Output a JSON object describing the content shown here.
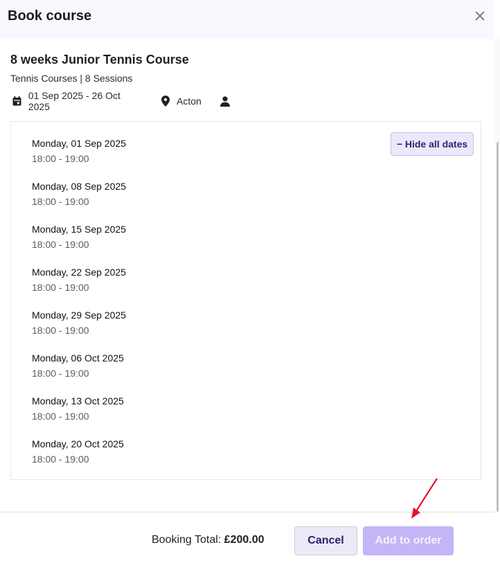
{
  "dialog": {
    "title": "Book course",
    "close_icon": "close-icon"
  },
  "course": {
    "title": "8 weeks Junior Tennis Course",
    "subtitle": "Tennis Courses | 8 Sessions",
    "date_range": "01 Sep 2025 - 26 Oct 2025",
    "location": "Acton",
    "icons": {
      "date": "calendar-icon",
      "location": "location-pin-icon",
      "person": "person-icon"
    }
  },
  "sessions": {
    "toggle_label": "− Hide all dates",
    "items": [
      {
        "date": "Monday, 01 Sep 2025",
        "time": "18:00 - 19:00"
      },
      {
        "date": "Monday, 08 Sep 2025",
        "time": "18:00 - 19:00"
      },
      {
        "date": "Monday, 15 Sep 2025",
        "time": "18:00 - 19:00"
      },
      {
        "date": "Monday, 22 Sep 2025",
        "time": "18:00 - 19:00"
      },
      {
        "date": "Monday, 29 Sep 2025",
        "time": "18:00 - 19:00"
      },
      {
        "date": "Monday, 06 Oct 2025",
        "time": "18:00 - 19:00"
      },
      {
        "date": "Monday, 13 Oct 2025",
        "time": "18:00 - 19:00"
      },
      {
        "date": "Monday, 20 Oct 2025",
        "time": "18:00 - 19:00"
      }
    ]
  },
  "footer": {
    "total_label": "Booking Total:",
    "total_value": "£200.00",
    "cancel_label": "Cancel",
    "add_label": "Add to order"
  },
  "colors": {
    "accent": "#c4b5f6",
    "cancel_bg": "#eceaf6",
    "header_bg": "#faf8fe",
    "annotation": "#e8132f"
  }
}
